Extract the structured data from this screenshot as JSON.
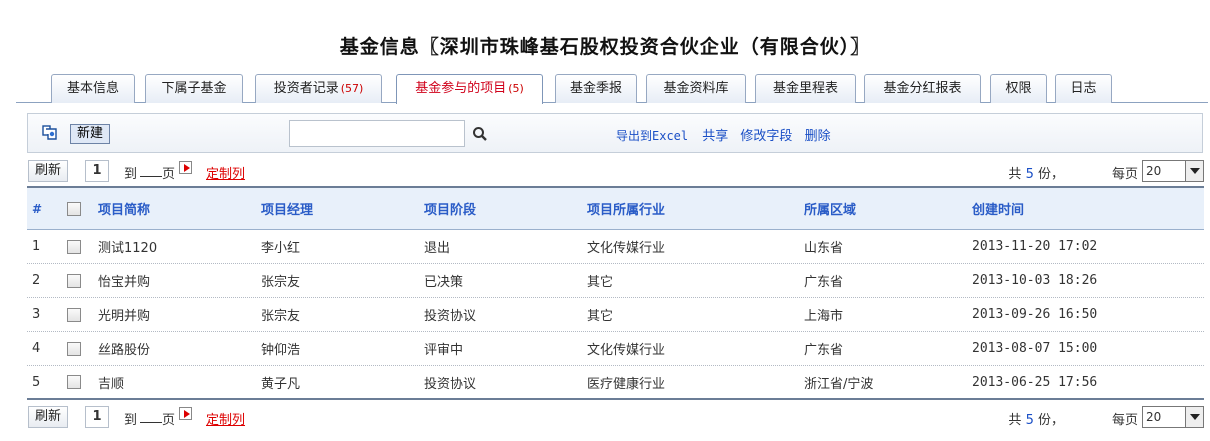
{
  "title": "基金信息〖深圳市珠峰基石股权投资合伙企业（有限合伙）〗",
  "tabs": [
    {
      "label": "基本信息",
      "count": ""
    },
    {
      "label": "下属子基金",
      "count": ""
    },
    {
      "label": "投资者记录",
      "count": "(57)"
    },
    {
      "label": "基金参与的项目",
      "count": "(5)",
      "active": true
    },
    {
      "label": "基金季报",
      "count": ""
    },
    {
      "label": "基金资料库",
      "count": ""
    },
    {
      "label": "基金里程表",
      "count": ""
    },
    {
      "label": "基金分红报表",
      "count": ""
    },
    {
      "label": "权限",
      "count": ""
    },
    {
      "label": "日志",
      "count": ""
    }
  ],
  "toolbar": {
    "new_label": "新建",
    "search_value": "",
    "export_label": "导出到Excel",
    "share_label": "共享",
    "edit_fields_label": "修改字段",
    "delete_label": "删除"
  },
  "pager": {
    "refresh_label": "刷新",
    "page": "1",
    "to_label": "到",
    "page_label": "页",
    "custom_columns_label": "定制列",
    "total_prefix": "共",
    "total_count": "5",
    "total_suffix": "份，",
    "per_page_label": "每页",
    "page_size": "20"
  },
  "table": {
    "columns": [
      "#",
      "项目简称",
      "项目经理",
      "项目阶段",
      "项目所属行业",
      "所属区域",
      "创建时间"
    ],
    "rows": [
      [
        "1",
        "测试1120",
        "李小红",
        "退出",
        "文化传媒行业",
        "山东省",
        "2013-11-20 17:02"
      ],
      [
        "2",
        "怡宝并购",
        "张宗友",
        "已决策",
        "其它",
        "广东省",
        "2013-10-03 18:26"
      ],
      [
        "3",
        "光明并购",
        "张宗友",
        "投资协议",
        "其它",
        "上海市",
        "2013-09-26 16:50"
      ],
      [
        "4",
        "丝路股份",
        "钟仰浩",
        "评审中",
        "文化传媒行业",
        "广东省",
        "2013-08-07 15:00"
      ],
      [
        "5",
        "吉顺",
        "黄子凡",
        "投资协议",
        "医疗健康行业",
        "浙江省/宁波",
        "2013-06-25 17:56"
      ]
    ]
  },
  "colors": {
    "accent": "#2a5cc7",
    "active_tab": "#d0021b",
    "link": "#1a4fc6"
  },
  "icons": {
    "new": "new-record-icon",
    "search": "search-icon",
    "next_page": "play-arrow-icon",
    "select": "chevron-down-icon"
  }
}
